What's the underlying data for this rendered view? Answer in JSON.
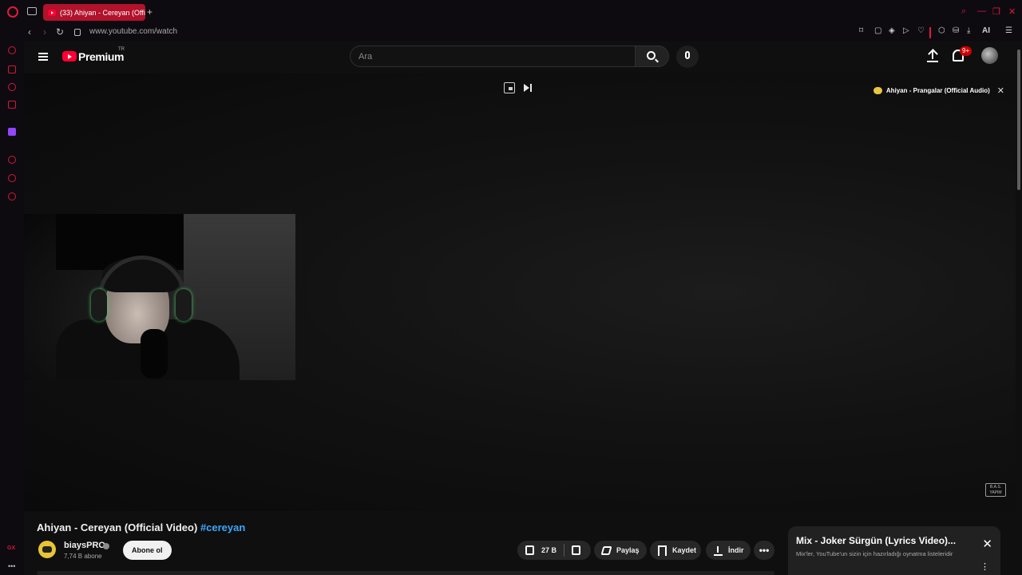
{
  "browser": {
    "tab_title": "(33) Ahiyan - Cereyan (Offi",
    "url": "www.youtube.com/watch",
    "new_tab_symbol": "+",
    "toolbar_ai": "AI",
    "accent": "#e2193f"
  },
  "header": {
    "logo_text": "Premium",
    "logo_region": "TR",
    "search_placeholder": "Ara",
    "notification_badge": "9+"
  },
  "player": {
    "up_next_label": "Ahiyan - Prangalar (Official Audio)",
    "watermark": "B.A.S. YAPIM"
  },
  "video": {
    "title": "Ahiyan - Cereyan (Official Video)",
    "hashtag": "#cereyan",
    "channel_name": "biaysPRO",
    "subscribers": "7,74 B abone",
    "subscribe_label": "Abone ol",
    "like_count": "27 B",
    "share_label": "Paylaş",
    "save_label": "Kaydet",
    "download_label": "İndir",
    "more_label": "•••"
  },
  "mix": {
    "title": "Mix - Joker Sürgün (Lyrics Video)...",
    "subtitle": "Mix'ler, YouTube'un sizin için hazırladığı oynatma listeleridir",
    "more_label": "⋮"
  },
  "sidebar": {
    "gx_label": "GX",
    "more_label": "•••"
  }
}
